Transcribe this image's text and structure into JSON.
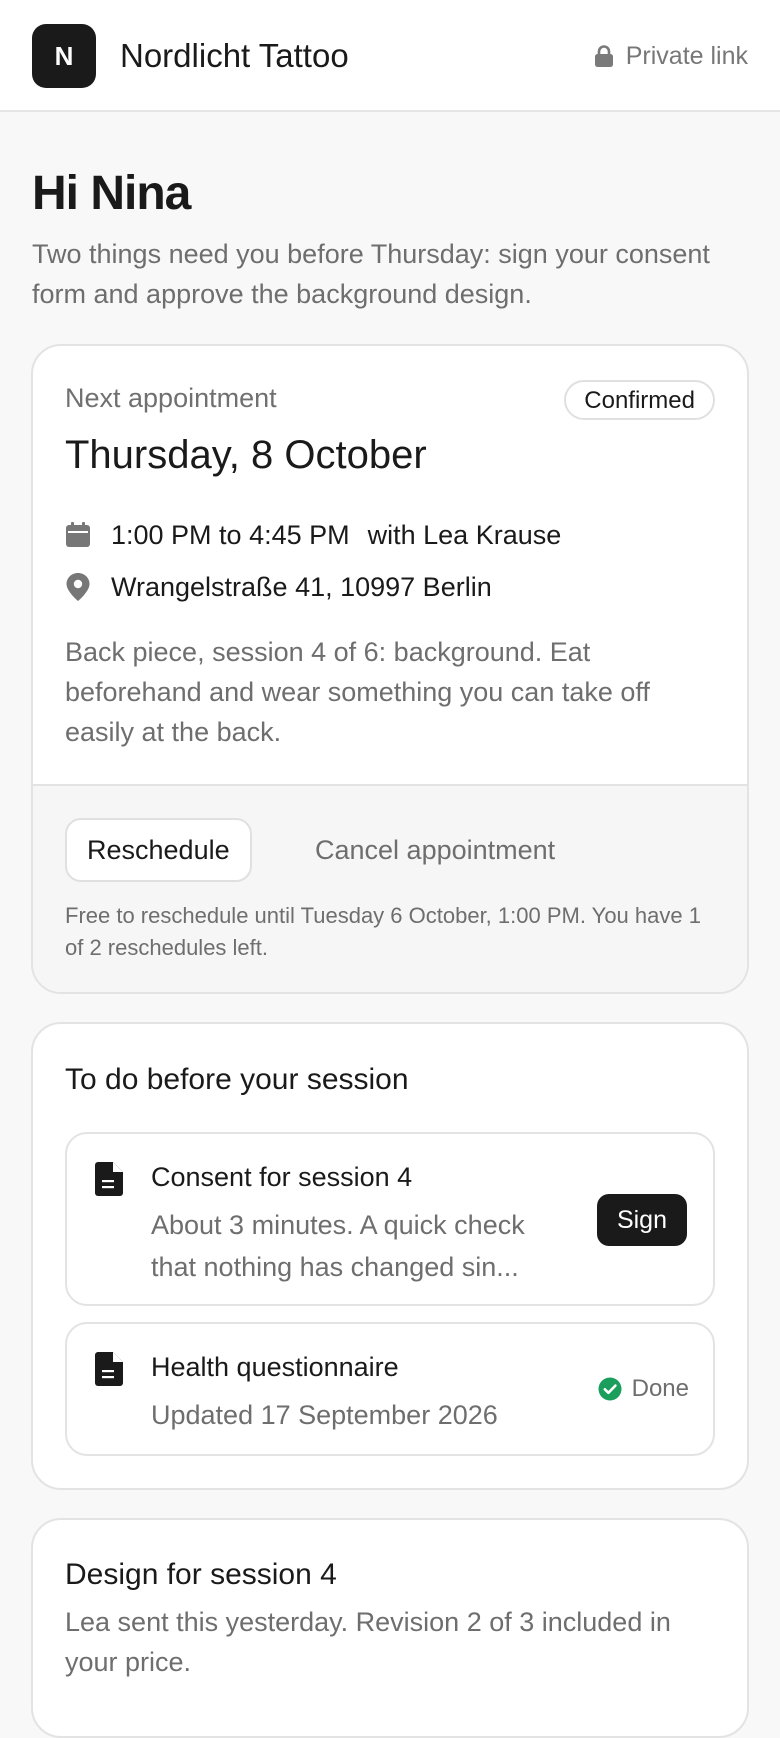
{
  "header": {
    "logo_letter": "N",
    "studio_name": "Nordlicht Tattoo",
    "privacy_label": "Private link"
  },
  "greeting": {
    "title": "Hi Nina",
    "message": "Two things need you before Thursday: sign your consent form and approve the background design."
  },
  "appointment": {
    "label": "Next appointment",
    "status": "Confirmed",
    "date": "Thursday, 8 October",
    "time": "1:00 PM to 4:45 PM",
    "artist": "with Lea Krause",
    "address": "Wrangelstraße 41, 10997 Berlin",
    "note": "Back piece, session 4 of 6: background. Eat beforehand and wear something you can take off easily at the back.",
    "reschedule_label": "Reschedule",
    "cancel_label": "Cancel appointment",
    "policy": "Free to reschedule until Tuesday 6 October, 1:00 PM. You have 1 of 2 reschedules left."
  },
  "todo": {
    "title": "To do before your session",
    "tasks": [
      {
        "title": "Consent for session 4",
        "description": "About 3 minutes. A quick check that nothing has changed sin...",
        "action_label": "Sign"
      },
      {
        "title": "Health questionnaire",
        "description": "Updated 17 September 2026",
        "status_label": "Done"
      }
    ]
  },
  "design": {
    "title": "Design for session 4",
    "description": "Lea sent this yesterday. Revision 2 of 3 included in your price."
  },
  "colors": {
    "primary": "#1a1a1a",
    "muted_text": "#6e6e6e",
    "done_green": "#1a9e5c",
    "border": "#e3e3e3"
  },
  "icons": {
    "lock": "lock-icon",
    "calendar": "calendar-icon",
    "location": "map-pin-icon",
    "document": "document-icon",
    "check": "check-circle-icon"
  }
}
